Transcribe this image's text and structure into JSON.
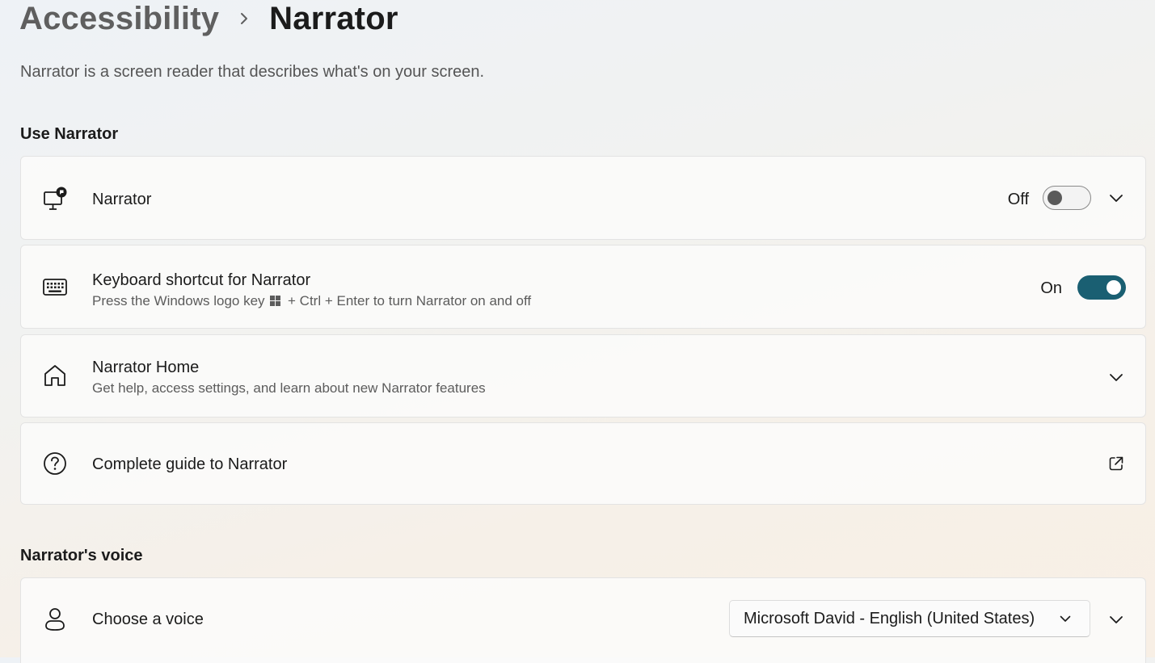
{
  "breadcrumb": {
    "parent": "Accessibility",
    "current": "Narrator"
  },
  "page_description": "Narrator is a screen reader that describes what's on your screen.",
  "sections": {
    "use_narrator": {
      "title": "Use Narrator",
      "narrator": {
        "icon": "narrator-monitor-icon",
        "title": "Narrator",
        "toggle_state": "Off"
      },
      "keyboard_shortcut": {
        "icon": "keyboard-icon",
        "title": "Keyboard shortcut for Narrator",
        "subtitle_before": "Press the Windows logo key",
        "subtitle_after": "+ Ctrl + Enter to turn Narrator on and off",
        "toggle_state": "On"
      },
      "narrator_home": {
        "icon": "home-icon",
        "title": "Narrator Home",
        "subtitle": "Get help, access settings, and learn about new Narrator features"
      },
      "complete_guide": {
        "icon": "help-circle-icon",
        "title": "Complete guide to Narrator",
        "action_icon": "open-external-icon"
      }
    },
    "narrators_voice": {
      "title": "Narrator's voice",
      "choose_voice": {
        "icon": "person-icon",
        "title": "Choose a voice",
        "selected_voice": "Microsoft David - English (United States)"
      }
    }
  },
  "colors": {
    "accent": "#1a5f72",
    "text_primary": "#1b1b1b",
    "text_secondary": "#5c5c5c"
  }
}
